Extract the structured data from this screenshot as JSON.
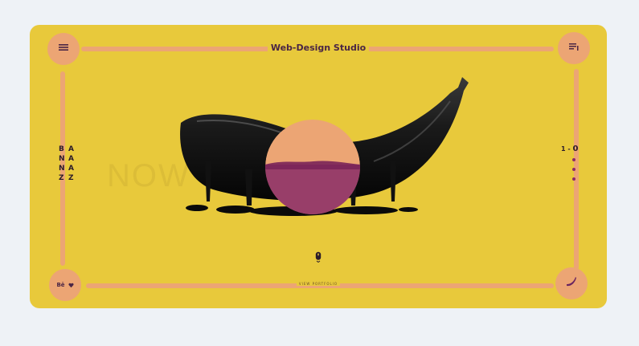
{
  "header": {
    "title": "Web-Design Studio"
  },
  "brand": {
    "letters": [
      "B",
      "A",
      "N",
      "A",
      "N",
      "A",
      "Z",
      "Z"
    ]
  },
  "background_word": "NOW",
  "slider": {
    "current": "1",
    "separator": "-",
    "total": "0",
    "dot_count": 3
  },
  "footer": {
    "label": "VIEW PORTFOLIO",
    "social_label": "Bē"
  },
  "colors": {
    "background": "#eef2f6",
    "card": "#e8c93b",
    "accent": "#eca574",
    "orb_overlay": "#8a2b67",
    "text_dark": "#4a2545"
  },
  "icons": {
    "top_left": "hamburger-menu-icon",
    "top_right": "playlist-icon",
    "bottom_left": "behance-dribbble-icons",
    "bottom_right": "banana-icon",
    "scroll": "mouse-scroll-icon"
  }
}
